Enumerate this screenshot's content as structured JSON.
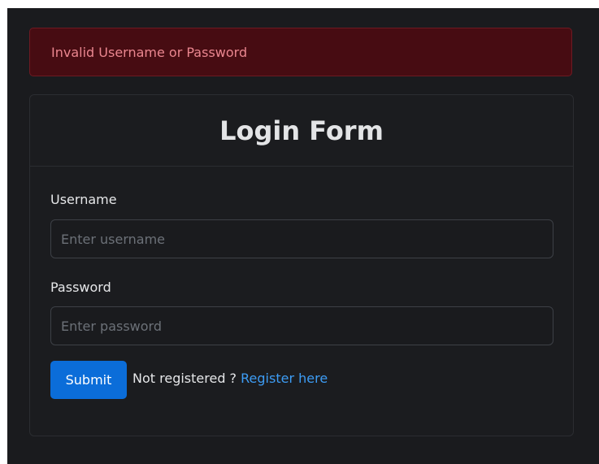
{
  "alert": {
    "message": "Invalid Username or Password",
    "color": "#ea868f",
    "background": "#470c12"
  },
  "form": {
    "title": "Login Form",
    "username": {
      "label": "Username",
      "placeholder": "Enter username",
      "value": ""
    },
    "password": {
      "label": "Password",
      "placeholder": "Enter password",
      "value": ""
    },
    "submit_label": "Submit",
    "register_prompt": "Not registered ?",
    "register_link": "Register here"
  },
  "colors": {
    "accent": "#0b6dd9",
    "link": "#3d9cf4",
    "background": "#1a1b1e"
  }
}
